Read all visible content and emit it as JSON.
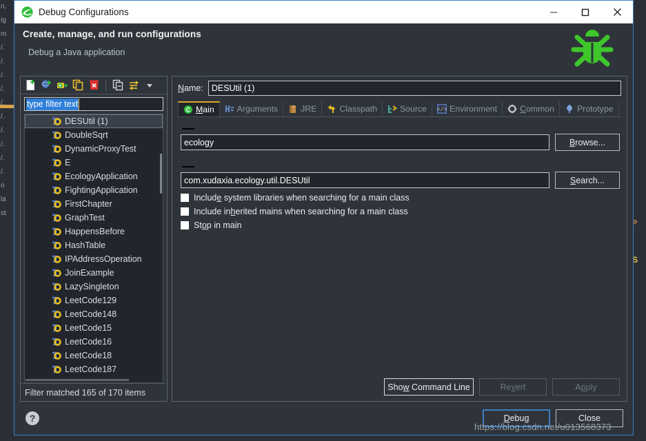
{
  "window": {
    "title": "Debug Configurations",
    "app_icon": "eclipse-icon",
    "minimize_label": "Minimize",
    "maximize_label": "Maximize",
    "close_label": "Close"
  },
  "banner": {
    "title": "Create, manage, and run configurations",
    "subtitle": "Debug a Java application",
    "icon": "bug-icon"
  },
  "toolbar": {
    "items": [
      {
        "name": "new-launch-configuration-icon",
        "tooltip": "New launch configuration"
      },
      {
        "name": "new-prototype-icon",
        "tooltip": "New prototype"
      },
      {
        "name": "export-icon",
        "tooltip": "Export"
      },
      {
        "name": "duplicate-icon",
        "tooltip": "Duplicate"
      },
      {
        "name": "delete-icon",
        "tooltip": "Delete"
      },
      {
        "name": "collapse-all-icon",
        "tooltip": "Collapse All"
      },
      {
        "name": "filter-icon",
        "tooltip": "Filter launch configurations"
      },
      {
        "name": "view-menu-icon",
        "tooltip": "View Menu"
      }
    ]
  },
  "filter": {
    "value": "type filter text",
    "placeholder": "type filter text",
    "status": "Filter matched 165 of 170 items"
  },
  "tree": {
    "items": [
      {
        "label": "DESUtil (1)",
        "selected": true
      },
      {
        "label": "DoubleSqrt",
        "selected": false
      },
      {
        "label": "DynamicProxyTest",
        "selected": false
      },
      {
        "label": "E",
        "selected": false
      },
      {
        "label": "EcologyApplication",
        "selected": false
      },
      {
        "label": "FightingApplication",
        "selected": false
      },
      {
        "label": "FirstChapter",
        "selected": false
      },
      {
        "label": "GraphTest",
        "selected": false
      },
      {
        "label": "HappensBefore",
        "selected": false
      },
      {
        "label": "HashTable",
        "selected": false
      },
      {
        "label": "IPAddressOperation",
        "selected": false
      },
      {
        "label": "JoinExample",
        "selected": false
      },
      {
        "label": "LazySingleton",
        "selected": false
      },
      {
        "label": "LeetCode129",
        "selected": false
      },
      {
        "label": "LeetCode148",
        "selected": false
      },
      {
        "label": "LeetCode15",
        "selected": false
      },
      {
        "label": "LeetCode16",
        "selected": false
      },
      {
        "label": "LeetCode18",
        "selected": false
      },
      {
        "label": "LeetCode187",
        "selected": false
      }
    ]
  },
  "config": {
    "name_label_pre": "N",
    "name_label_mnemonic": "N",
    "name_label": "Name:",
    "name_value": "DESUtil (1)",
    "tabs": [
      {
        "label": "Main",
        "icon": "main-class-icon",
        "active": true,
        "mnemonic": "M"
      },
      {
        "label": "Arguments",
        "icon": "arguments-icon",
        "active": false
      },
      {
        "label": "JRE",
        "icon": "jre-icon",
        "active": false
      },
      {
        "label": "Classpath",
        "icon": "classpath-icon",
        "active": false
      },
      {
        "label": "Source",
        "icon": "source-icon",
        "active": false
      },
      {
        "label": "Environment",
        "icon": "environment-icon",
        "active": false
      },
      {
        "label": "Common",
        "icon": "common-icon",
        "active": false
      },
      {
        "label": "Prototype",
        "icon": "prototype-icon",
        "active": false
      }
    ],
    "project_value": "ecology",
    "browse_label": "Browse...",
    "browse_mnemonic": "B",
    "main_class_value": "com.xudaxia.ecology.util.DESUtil",
    "search_label": "Search...",
    "search_mnemonic": "S",
    "checkboxes": [
      {
        "label_a": "Includ",
        "mnemonic": "e",
        "label_b": " system libraries when searching for a main class",
        "checked": false
      },
      {
        "label_a": "Include in",
        "mnemonic": "h",
        "label_b": "erited mains when searching for a main class",
        "checked": false
      },
      {
        "label_a": "St",
        "mnemonic": "o",
        "label_b": "p in main",
        "checked": false
      }
    ],
    "show_command_line_a": "Sho",
    "show_command_line_mnemonic": "w",
    "show_command_line_b": " Command Line",
    "revert_a": "Re",
    "revert_mnemonic": "v",
    "revert_b": "ert",
    "revert_enabled": false,
    "apply_a": "A",
    "apply_mnemonic": "p",
    "apply_b": "ply",
    "apply_enabled": false
  },
  "footer": {
    "help_icon": "help-icon",
    "debug_a": "",
    "debug_mnemonic": "D",
    "debug_b": "ebug",
    "close_label": "Close"
  },
  "watermark": "https://blog.csdn.net/u013568373",
  "background": {
    "left_lines": [
      "n,",
      "ig",
      "",
      "",
      "",
      "",
      "",
      "",
      "m",
      "/.",
      "/.",
      "/.",
      "/.",
      "/.",
      "/.",
      "/.",
      "/.",
      "/.",
      "/.",
      "o",
      "la",
      "st"
    ],
    "right_marker_1": "P",
    "right_marker_2": "S"
  },
  "colors": {
    "accent": "#3b7fc4",
    "tab_active_underline": "#e0a52a",
    "bug_green": "#3ec62b",
    "selection_blue": "#2f7fd8",
    "panel_bg": "#2f343b",
    "field_bg": "#22262c"
  }
}
